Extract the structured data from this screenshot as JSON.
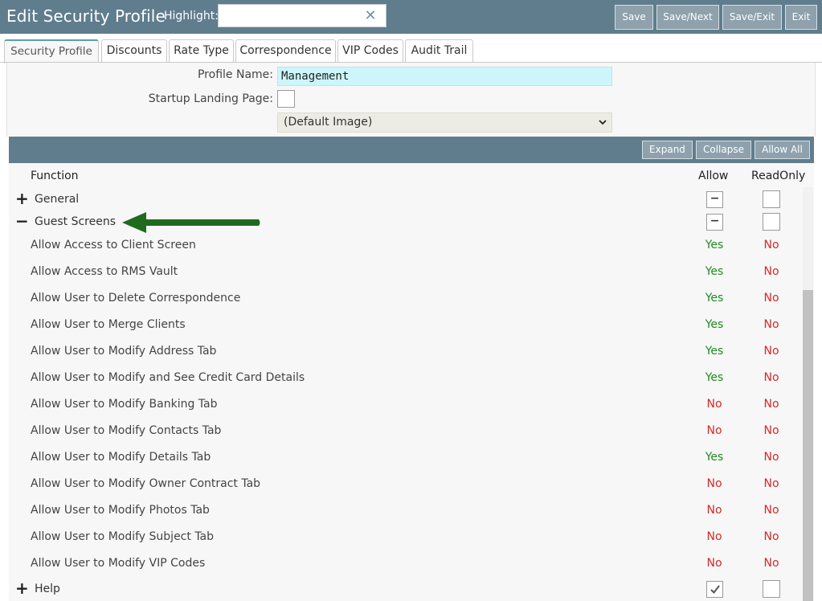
{
  "header": {
    "title": "Edit Security Profile",
    "highlight_label": "Highlight:",
    "highlight_value": "",
    "buttons": [
      {
        "label": "Save"
      },
      {
        "label": "Save/Next"
      },
      {
        "label": "Save/Exit"
      },
      {
        "label": "Exit"
      }
    ]
  },
  "tabs": [
    {
      "label": "Security Profile"
    },
    {
      "label": "Discounts"
    },
    {
      "label": "Rate Type"
    },
    {
      "label": "Correspondence"
    },
    {
      "label": "VIP Codes"
    },
    {
      "label": "Audit Trail"
    }
  ],
  "form": {
    "profile_name_label": "Profile Name:",
    "profile_name_value": "Management",
    "startup_label": "Startup Landing Page:",
    "image_select_value": "(Default Image)"
  },
  "grid_toolbar": {
    "expand": "Expand",
    "collapse": "Collapse",
    "allow_all": "Allow All"
  },
  "grid": {
    "col_function": "Function",
    "col_allow": "Allow",
    "col_readonly": "ReadOnly",
    "groups": [
      {
        "label": "General",
        "expander": "+",
        "allow_state": "−",
        "readonly_state": ""
      },
      {
        "label": "Guest Screens",
        "expander": "−",
        "allow_state": "−",
        "readonly_state": ""
      },
      {
        "label": "Help",
        "expander": "+",
        "allow_state": "checked",
        "readonly_state": ""
      }
    ],
    "functions": [
      {
        "label": "Allow Access to Client Screen",
        "allow": "Yes",
        "readonly": "No"
      },
      {
        "label": "Allow Access to RMS Vault",
        "allow": "Yes",
        "readonly": "No"
      },
      {
        "label": "Allow User to Delete Correspondence",
        "allow": "Yes",
        "readonly": "No"
      },
      {
        "label": "Allow User to Merge Clients",
        "allow": "Yes",
        "readonly": "No"
      },
      {
        "label": "Allow User to Modify Address Tab",
        "allow": "Yes",
        "readonly": "No"
      },
      {
        "label": "Allow User to Modify and See Credit Card Details",
        "allow": "Yes",
        "readonly": "No"
      },
      {
        "label": "Allow User to Modify Banking Tab",
        "allow": "No",
        "readonly": "No"
      },
      {
        "label": "Allow User to Modify Contacts Tab",
        "allow": "No",
        "readonly": "No"
      },
      {
        "label": "Allow User to Modify Details Tab",
        "allow": "Yes",
        "readonly": "No"
      },
      {
        "label": "Allow User to Modify Owner Contract Tab",
        "allow": "No",
        "readonly": "No"
      },
      {
        "label": "Allow User to Modify Photos Tab",
        "allow": "No",
        "readonly": "No"
      },
      {
        "label": "Allow User to Modify Subject Tab",
        "allow": "No",
        "readonly": "No"
      },
      {
        "label": "Allow User to Modify VIP Codes",
        "allow": "No",
        "readonly": "No"
      }
    ]
  },
  "colors": {
    "header_bg": "#5f7d8d",
    "button_bg": "#8ea1ad",
    "yes": "#1f8a1f",
    "no": "#d42a2a",
    "annotation_arrow": "#1e6b1e",
    "profile_input_bg": "#ccf6fb"
  },
  "icons": {
    "clear": "close-x-icon",
    "select": "chevron-down-icon",
    "checked": "check-mark-icon",
    "annotation": "left-arrow-icon"
  }
}
